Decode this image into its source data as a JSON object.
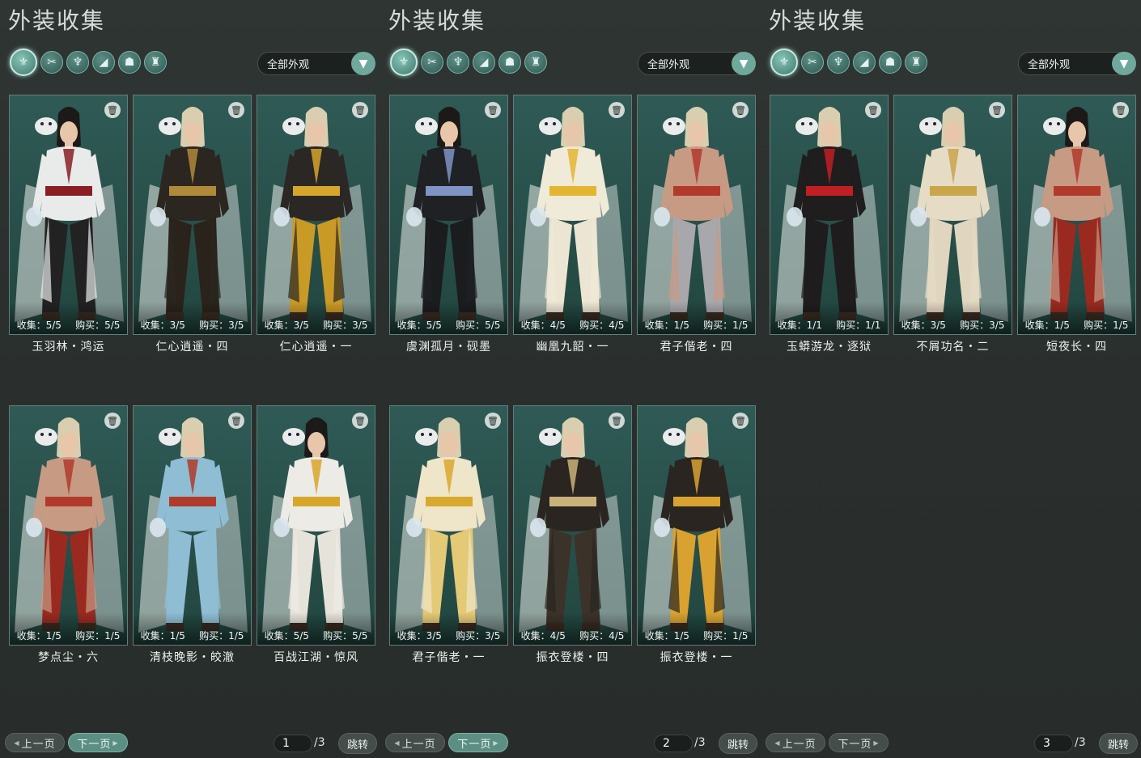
{
  "colors": {
    "accent": "#6fa99c",
    "card_bg": "#2a524d",
    "bg": "#2b302e"
  },
  "category_icons": [
    "outfit-icon",
    "hat-icon",
    "top-icon",
    "shoe-icon",
    "mask-icon",
    "pants-icon"
  ],
  "panels": [
    {
      "title": "外装收集",
      "filter_label": "全部外观",
      "cards": [
        {
          "collect": "收集：5/5",
          "buy": "购买：5/5",
          "name": "玉羽林・鸿运",
          "outfit": "#e8ebea",
          "accent": "#8a1e24",
          "legs": "#222",
          "hair": "#1c1a18"
        },
        {
          "collect": "收集：3/5",
          "buy": "购买：3/5",
          "name": "仁心逍遥・四",
          "outfit": "#2b2620",
          "accent": "#b08a3a",
          "legs": "#2a231b",
          "hair": "#d9ceb0"
        },
        {
          "collect": "收集：3/5",
          "buy": "购买：3/5",
          "name": "仁心逍遥・一",
          "outfit": "#2a2724",
          "accent": "#d5a52c",
          "legs": "#c99a26",
          "hair": "#d9ceb0"
        },
        {
          "collect": "收集：1/5",
          "buy": "购买：1/5",
          "name": "梦点尘・六",
          "outfit": "#c79a84",
          "accent": "#b23a2a",
          "legs": "#9a2a20",
          "hair": "#d9ceb0"
        },
        {
          "collect": "收集：1/5",
          "buy": "购买：1/5",
          "name": "清枝晚影・皎澈",
          "outfit": "#8fbdd4",
          "accent": "#b23a2a",
          "legs": "#8fbdd4",
          "hair": "#d9ceb0"
        },
        {
          "collect": "收集：5/5",
          "buy": "购买：5/5",
          "name": "百战江湖・惊风",
          "outfit": "#ecebe6",
          "accent": "#d8a72a",
          "legs": "#e6e3da",
          "hair": "#1c1a18"
        }
      ],
      "pager": {
        "prev": "上一页",
        "next": "下一页",
        "page": "1",
        "total": "/3",
        "jump": "跳转"
      }
    },
    {
      "title": "外装收集",
      "filter_label": "全部外观",
      "cards": [
        {
          "collect": "收集：5/5",
          "buy": "购买：5/5",
          "name": "虞渊孤月・砚墨",
          "outfit": "#1f2124",
          "accent": "#7f93c4",
          "legs": "#1b1c1e",
          "hair": "#1c1a18"
        },
        {
          "collect": "收集：4/5",
          "buy": "购买：4/5",
          "name": "幽凰九韶・一",
          "outfit": "#f0ead8",
          "accent": "#e3b632",
          "legs": "#ece5d3",
          "hair": "#d9ceb0"
        },
        {
          "collect": "收集：1/5",
          "buy": "购买：1/5",
          "name": "君子偕老・四",
          "outfit": "#c79a84",
          "accent": "#b23a2a",
          "legs": "#a8a8ac",
          "hair": "#d9ceb0"
        },
        {
          "collect": "收集：3/5",
          "buy": "购买：3/5",
          "name": "君子偕老・一",
          "outfit": "#efe5c8",
          "accent": "#d9a82e",
          "legs": "#e4c976",
          "hair": "#d9ceb0"
        },
        {
          "collect": "收集：4/5",
          "buy": "购买：4/5",
          "name": "振衣登楼・四",
          "outfit": "#2a2520",
          "accent": "#c9b27a",
          "legs": "#3b332a",
          "hair": "#d9ceb0"
        },
        {
          "collect": "收集：1/5",
          "buy": "购买：1/5",
          "name": "振衣登楼・一",
          "outfit": "#2a2520",
          "accent": "#d9a230",
          "legs": "#d9a230",
          "hair": "#d9ceb0"
        }
      ],
      "pager": {
        "prev": "上一页",
        "next": "下一页",
        "page": "2",
        "total": "/3",
        "jump": "跳转"
      }
    },
    {
      "title": "外装收集",
      "filter_label": "全部外观",
      "cards": [
        {
          "collect": "收集：1/1",
          "buy": "购买：1/1",
          "name": "玉蟒游龙・逐狱",
          "outfit": "#1f1d1d",
          "accent": "#c21f24",
          "legs": "#1e1c1c",
          "hair": "#d9ceb0"
        },
        {
          "collect": "收集：3/5",
          "buy": "购买：3/5",
          "name": "不屑功名・二",
          "outfit": "#e6dcc6",
          "accent": "#c9a64a",
          "legs": "#e0d5bf",
          "hair": "#d9ceb0"
        },
        {
          "collect": "收集：1/5",
          "buy": "购买：1/5",
          "name": "短夜长・四",
          "outfit": "#c79a84",
          "accent": "#b23a2a",
          "legs": "#9a2a20",
          "hair": "#1c1a18"
        }
      ],
      "pager": {
        "prev": "上一页",
        "next": "下一页",
        "page": "3",
        "total": "/3",
        "jump": "跳转"
      }
    }
  ]
}
